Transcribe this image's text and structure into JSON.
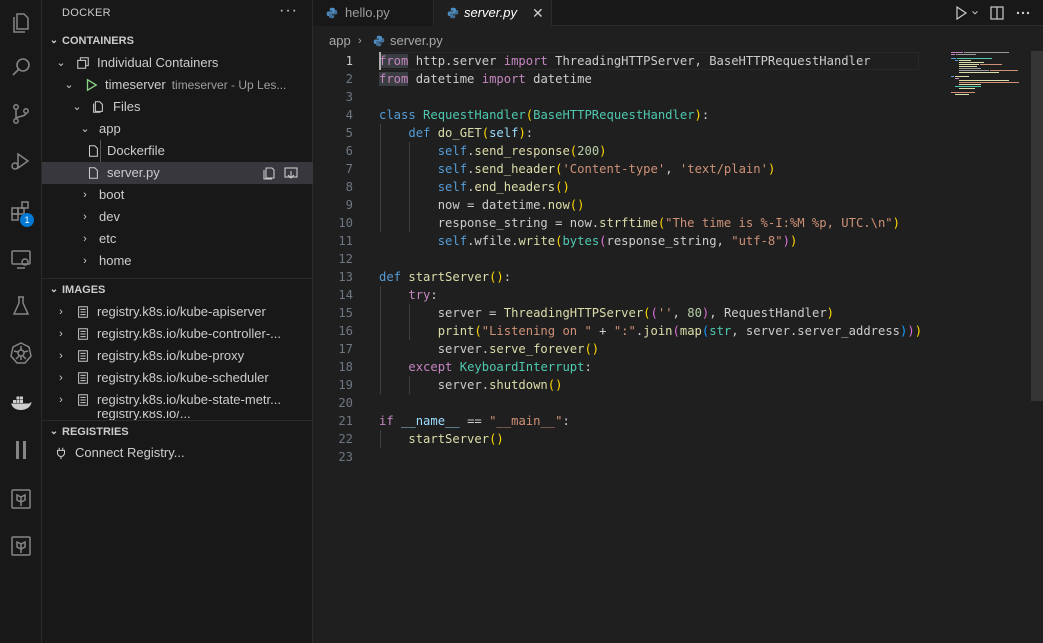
{
  "activity_bar": {
    "icons": [
      "files-icon",
      "search-icon",
      "source-control-icon",
      "run-debug-icon",
      "extensions-icon",
      "remote-explorer-icon",
      "testing-icon",
      "kubernetes-icon",
      "docker-icon",
      "pause-icon",
      "terraform-icon",
      "terraform-cloud-icon"
    ],
    "extensions_badge": "1"
  },
  "sidebar": {
    "title": "DOCKER",
    "more": "···",
    "containers": {
      "header": "CONTAINERS",
      "group": "Individual Containers",
      "container_name": "timeserver",
      "container_desc": "timeserver - Up Les...",
      "files": "Files",
      "app": "app",
      "dockerfile": "Dockerfile",
      "server_py": "server.py",
      "folders": [
        "boot",
        "dev",
        "etc",
        "home"
      ]
    },
    "images": {
      "header": "IMAGES",
      "items": [
        "registry.k8s.io/kube-apiserver",
        "registry.k8s.io/kube-controller-...",
        "registry.k8s.io/kube-proxy",
        "registry.k8s.io/kube-scheduler",
        "registry.k8s.io/kube-state-metr...",
        "registry.k8s.io/..."
      ]
    },
    "registries": {
      "header": "REGISTRIES",
      "connect": "Connect Registry..."
    }
  },
  "tabs": [
    {
      "label": "hello.py",
      "active": false
    },
    {
      "label": "server.py",
      "active": true
    }
  ],
  "breadcrumbs": [
    "app",
    "server.py"
  ],
  "editor": {
    "line_numbers": [
      "1",
      "2",
      "3",
      "4",
      "5",
      "6",
      "7",
      "8",
      "9",
      "10",
      "11",
      "12",
      "13",
      "14",
      "15",
      "16",
      "17",
      "18",
      "19",
      "20",
      "21",
      "22",
      "23"
    ],
    "current_line": 1
  },
  "colors": {
    "background": "#1f1f1f",
    "sidebar": "#181818",
    "accent": "#0078d4",
    "selection": "#37373d",
    "run_icon": "#89d185"
  }
}
